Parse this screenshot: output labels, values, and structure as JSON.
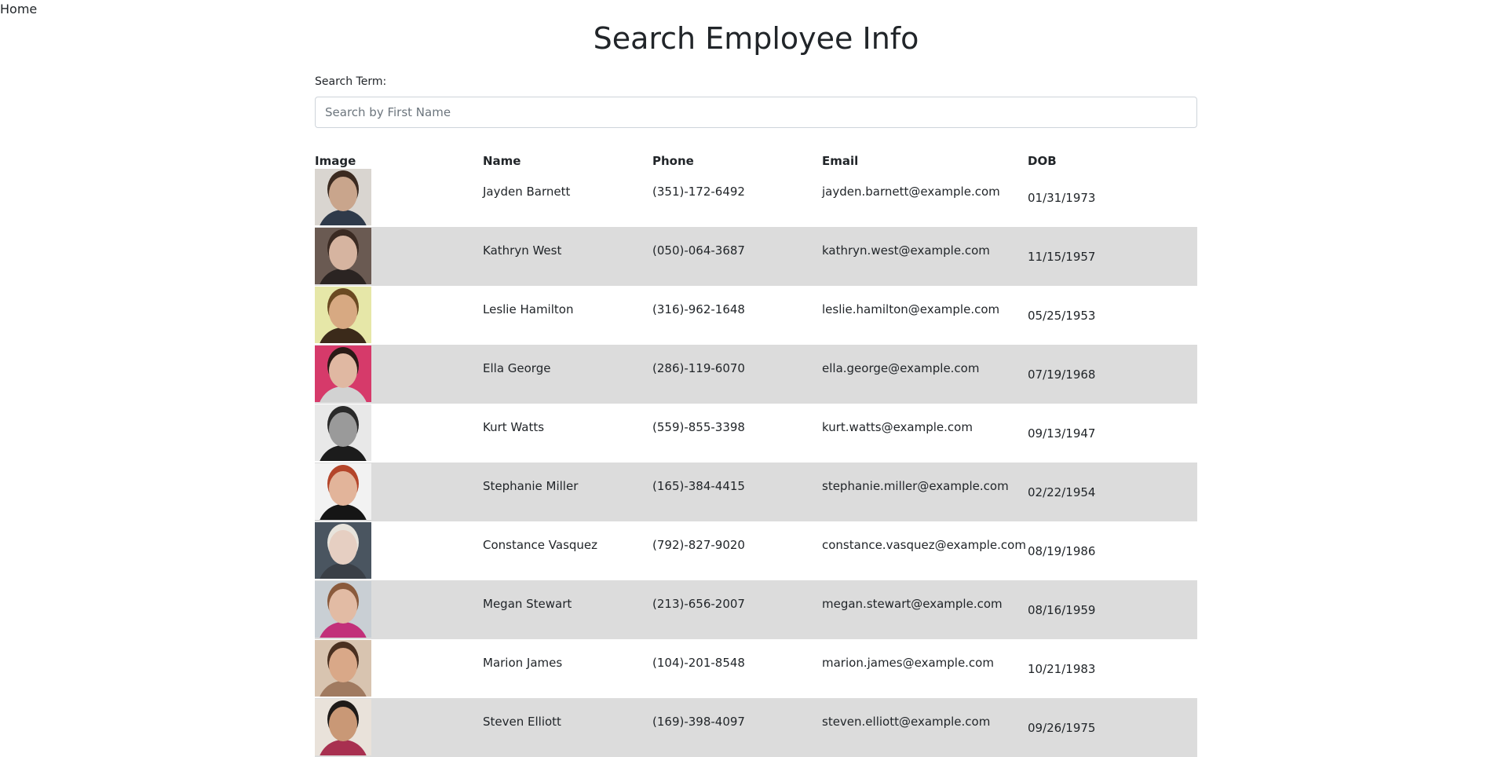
{
  "nav": {
    "home_label": "Home"
  },
  "page": {
    "title": "Search Employee Info"
  },
  "search": {
    "label": "Search Term:",
    "placeholder": "Search by First Name",
    "value": ""
  },
  "table": {
    "headers": {
      "image": "Image",
      "name": "Name",
      "phone": "Phone",
      "email": "Email",
      "dob": "DOB"
    },
    "rows": [
      {
        "name": "Jayden Barnett",
        "phone": "(351)-172-6492",
        "email": "jayden.barnett@example.com",
        "dob": "01/31/1973",
        "avatar": {
          "bg": "#d9d5d0",
          "skin": "#c9a58c",
          "hair": "#3b2a20",
          "shirt": "#2f3a4a"
        }
      },
      {
        "name": "Kathryn West",
        "phone": "(050)-064-3687",
        "email": "kathryn.west@example.com",
        "dob": "11/15/1957",
        "avatar": {
          "bg": "#6a5a52",
          "skin": "#d6b4a0",
          "hair": "#3a2a22",
          "shirt": "#2b2422"
        }
      },
      {
        "name": "Leslie Hamilton",
        "phone": "(316)-962-1648",
        "email": "leslie.hamilton@example.com",
        "dob": "05/25/1953",
        "avatar": {
          "bg": "#e6e7a8",
          "skin": "#d7a982",
          "hair": "#6b4a22",
          "shirt": "#3b2a1a"
        }
      },
      {
        "name": "Ella George",
        "phone": "(286)-119-6070",
        "email": "ella.george@example.com",
        "dob": "07/19/1968",
        "avatar": {
          "bg": "#d63a6a",
          "skin": "#e0b8a2",
          "hair": "#2a1a16",
          "shirt": "#d2d2d2"
        }
      },
      {
        "name": "Kurt Watts",
        "phone": "(559)-855-3398",
        "email": "kurt.watts@example.com",
        "dob": "09/13/1947",
        "avatar": {
          "bg": "#e8e8e8",
          "skin": "#9a9a9a",
          "hair": "#2a2a2a",
          "shirt": "#1c1c1c"
        }
      },
      {
        "name": "Stephanie Miller",
        "phone": "(165)-384-4415",
        "email": "stephanie.miller@example.com",
        "dob": "02/22/1954",
        "avatar": {
          "bg": "#f2f2f2",
          "skin": "#e2b49a",
          "hair": "#b4452a",
          "shirt": "#151515"
        }
      },
      {
        "name": "Constance Vasquez",
        "phone": "(792)-827-9020",
        "email": "constance.vasquez@example.com",
        "dob": "08/19/1986",
        "avatar": {
          "bg": "#4a5560",
          "skin": "#e6cfc2",
          "hair": "#e8e4dc",
          "shirt": "#3a3f46"
        }
      },
      {
        "name": "Megan Stewart",
        "phone": "(213)-656-2007",
        "email": "megan.stewart@example.com",
        "dob": "08/16/1959",
        "avatar": {
          "bg": "#c9cfd4",
          "skin": "#e2bba4",
          "hair": "#8a5a3c",
          "shirt": "#c2307a"
        }
      },
      {
        "name": "Marion James",
        "phone": "(104)-201-8548",
        "email": "marion.james@example.com",
        "dob": "10/21/1983",
        "avatar": {
          "bg": "#d8c4b0",
          "skin": "#d9a888",
          "hair": "#4a3020",
          "shirt": "#a07a60"
        }
      },
      {
        "name": "Steven Elliott",
        "phone": "(169)-398-4097",
        "email": "steven.elliott@example.com",
        "dob": "09/26/1975",
        "avatar": {
          "bg": "#e9e2da",
          "skin": "#c99876",
          "hair": "#1e1a18",
          "shirt": "#a83050"
        }
      }
    ]
  }
}
